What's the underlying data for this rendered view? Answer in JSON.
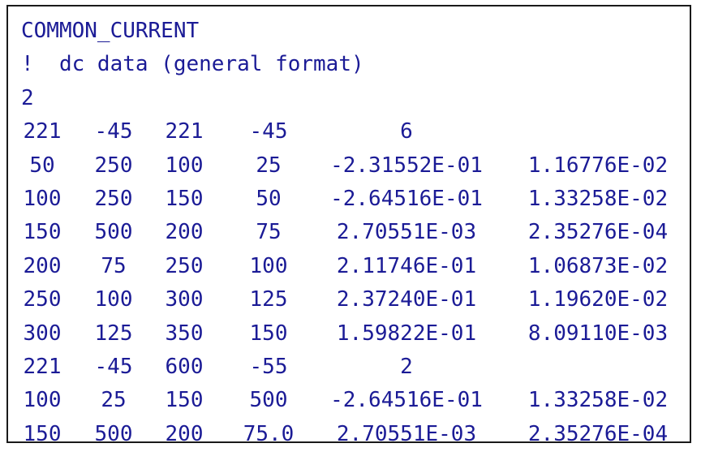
{
  "header_lines": [
    "COMMON_CURRENT",
    "!  dc data (general format)",
    "2"
  ],
  "rows": [
    [
      "221",
      "-45",
      "221",
      "-45",
      "6",
      ""
    ],
    [
      "50",
      "250",
      "100",
      "25",
      "-2.31552E-01",
      "1.16776E-02"
    ],
    [
      "100",
      "250",
      "150",
      "50",
      "-2.64516E-01",
      "1.33258E-02"
    ],
    [
      "150",
      "500",
      "200",
      "75",
      "2.70551E-03",
      "2.35276E-04"
    ],
    [
      "200",
      "75",
      "250",
      "100",
      "2.11746E-01",
      "1.06873E-02"
    ],
    [
      "250",
      "100",
      "300",
      "125",
      "2.37240E-01",
      "1.19620E-02"
    ],
    [
      "300",
      "125",
      "350",
      "150",
      "1.59822E-01",
      "8.09110E-03"
    ],
    [
      "221",
      "-45",
      "600",
      "-55",
      "2",
      ""
    ],
    [
      "100",
      "25",
      "150",
      "500",
      "-2.64516E-01",
      "1.33258E-02"
    ],
    [
      "150",
      "500",
      "200",
      "75.0",
      "2.70551E-03",
      "2.35276E-04"
    ]
  ],
  "text_color": "#1b1b96",
  "border_color": "#1a1a1a"
}
